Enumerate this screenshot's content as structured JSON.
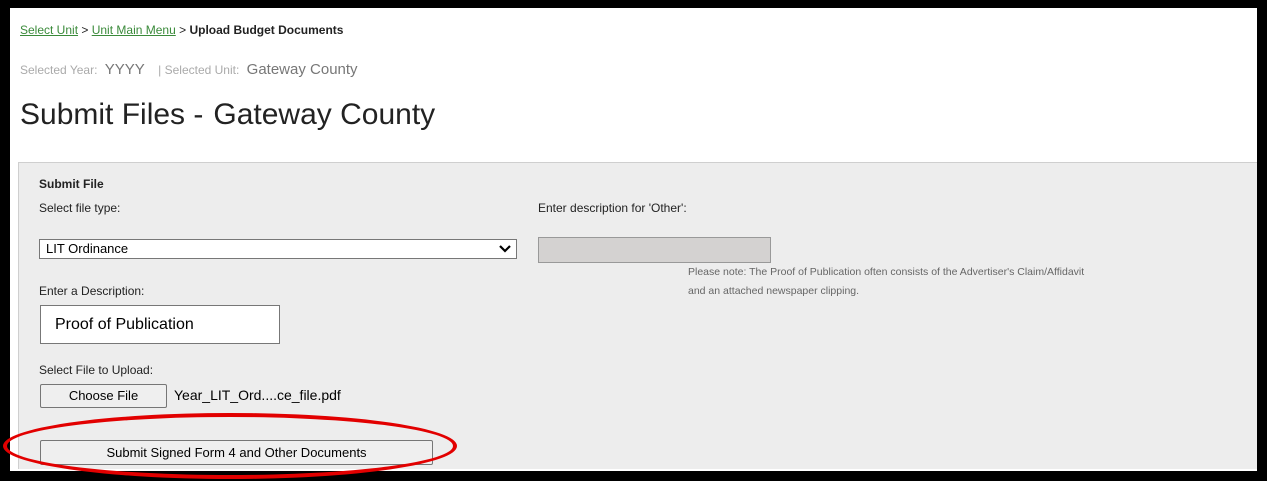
{
  "breadcrumb": {
    "link1": "Select Unit",
    "sep1": " > ",
    "link2": "Unit Main Menu",
    "sep2": " > ",
    "current": "Upload Budget Documents"
  },
  "selection": {
    "year_label": "Selected Year:",
    "year_value": "YYYY",
    "separator": "|",
    "unit_label": "Selected Unit:",
    "unit_value": "Gateway County"
  },
  "page_title": {
    "prefix": "Submit Files -",
    "unit": "Gateway County"
  },
  "form": {
    "section_title": "Submit File",
    "file_type_label": "Select file type:",
    "file_type_value": "LIT Ordinance",
    "other_label": "Enter description for 'Other':",
    "other_value": "",
    "note_line1": "Please note: The Proof of Publication often consists of the Advertiser's Claim/Affidavit",
    "note_line2": "and an attached newspaper clipping.",
    "description_label": "Enter a Description:",
    "description_value": "Proof of Publication",
    "file_label": "Select File to Upload:",
    "choose_button": "Choose File",
    "file_name": "Year_LIT_Ord....ce_file.pdf",
    "submit_button": "Submit Signed Form 4 and Other Documents"
  },
  "icons": {
    "dropdown": "chevron-down-icon"
  },
  "colors": {
    "link": "#3a8a3a",
    "highlight_oval": "#e20000",
    "panel_bg": "#ededed"
  }
}
